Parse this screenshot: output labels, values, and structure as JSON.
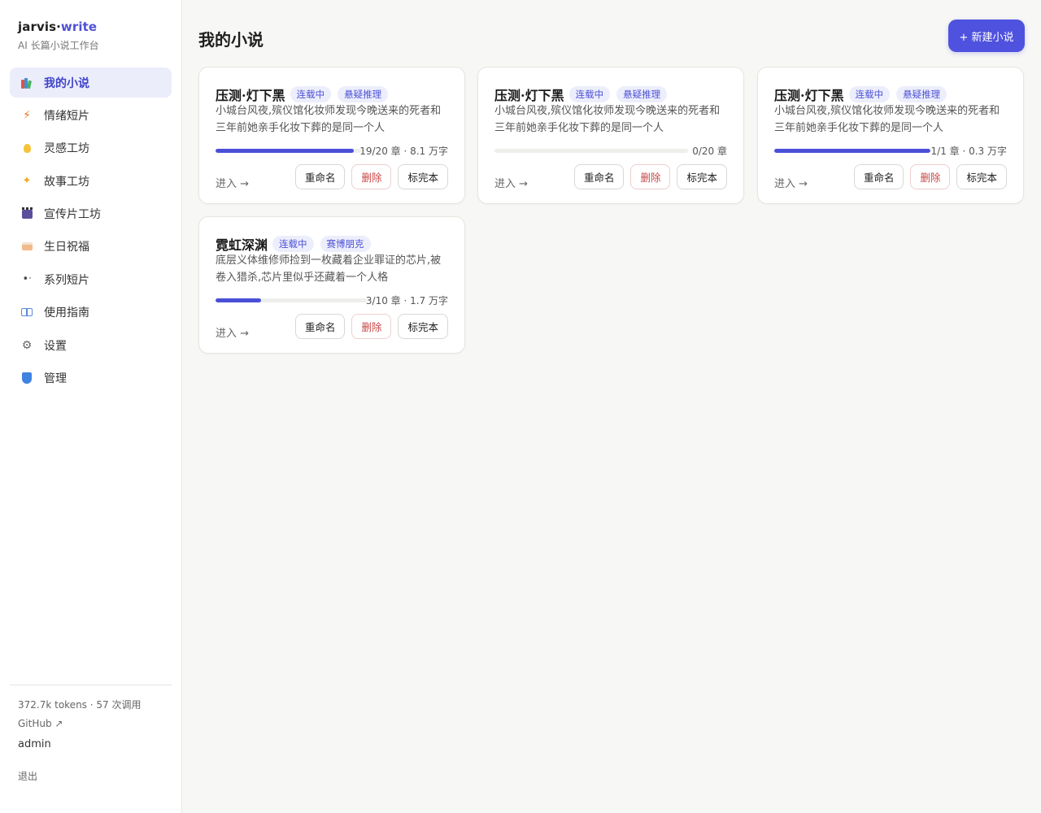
{
  "brand": {
    "name_prefix": "jarvis·",
    "name_accent": "write",
    "subtitle": "AI 长篇小说工作台"
  },
  "nav": [
    {
      "label": "我的小说",
      "icon": "books-icon",
      "active": true
    },
    {
      "label": "情绪短片",
      "icon": "lightning-icon"
    },
    {
      "label": "灵感工坊",
      "icon": "lightbulb-icon"
    },
    {
      "label": "故事工坊",
      "icon": "sparkles-icon"
    },
    {
      "label": "宣传片工坊",
      "icon": "clapperboard-icon"
    },
    {
      "label": "生日祝福",
      "icon": "cake-icon"
    },
    {
      "label": "系列短片",
      "icon": "paw-prints-icon"
    },
    {
      "label": "使用指南",
      "icon": "open-book-icon"
    },
    {
      "label": "设置",
      "icon": "gear-icon"
    },
    {
      "label": "管理",
      "icon": "shield-icon"
    }
  ],
  "footer": {
    "usage": "372.7k tokens · 57 次调用",
    "github": "GitHub ↗",
    "user": "admin",
    "logout": "退出"
  },
  "main": {
    "title": "我的小说",
    "new_button": "+ 新建小说",
    "card_actions": {
      "enter": "进入 →",
      "rename": "重命名",
      "delete": "删除",
      "finish": "标完本"
    },
    "novels": [
      {
        "title": "压测·灯下黑",
        "status": "连载中",
        "genre": "悬疑推理",
        "desc": "小城台风夜,殡仪馆化妆师发现今晚送来的死者和三年前她亲手化妆下葬的是同一个人",
        "progress": 0.95,
        "stats": "19/20 章 · 8.1 万字"
      },
      {
        "title": "压测·灯下黑",
        "status": "连载中",
        "genre": "悬疑推理",
        "desc": "小城台风夜,殡仪馆化妆师发现今晚送来的死者和三年前她亲手化妆下葬的是同一个人",
        "progress": 0,
        "stats": "0/20 章"
      },
      {
        "title": "压测·灯下黑",
        "status": "连载中",
        "genre": "悬疑推理",
        "desc": "小城台风夜,殡仪馆化妆师发现今晚送来的死者和三年前她亲手化妆下葬的是同一个人",
        "progress": 1.0,
        "stats": "1/1 章 · 0.3 万字"
      },
      {
        "title": "霓虹深渊",
        "status": "连载中",
        "genre": "赛博朋克",
        "desc": "底层义体维修师捡到一枚藏着企业罪证的芯片,被卷入猎杀,芯片里似乎还藏着一个人格",
        "progress": 0.3,
        "stats": "3/10 章 · 1.7 万字"
      }
    ]
  }
}
